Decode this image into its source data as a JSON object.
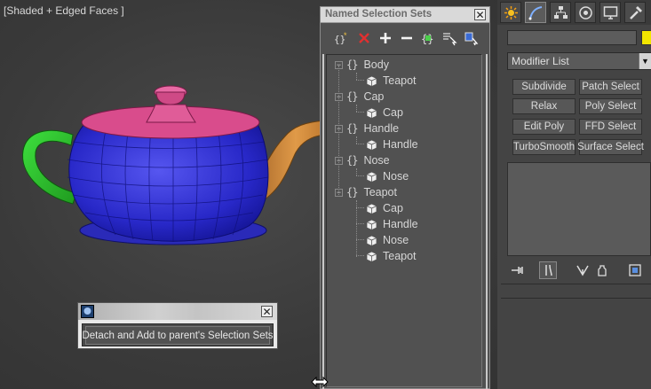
{
  "viewport": {
    "label": "[Shaded + Edged Faces ]",
    "teapot_parts": {
      "body": "#2e2ed4",
      "cap": "#d94c8c",
      "handle": "#2fc12f",
      "nose": "#d08a3a"
    }
  },
  "named_selection_sets": {
    "title": "Named Selection Sets",
    "toolbar": [
      {
        "name": "create-set-icon",
        "glyph": "{}*"
      },
      {
        "name": "delete-icon",
        "glyph": "✕"
      },
      {
        "name": "add-icon",
        "glyph": "+"
      },
      {
        "name": "subtract-icon",
        "glyph": "−"
      },
      {
        "name": "select-set-icon",
        "glyph": "{}"
      },
      {
        "name": "select-by-name-icon",
        "glyph": "▤"
      },
      {
        "name": "highlight-selected-icon",
        "glyph": "▦"
      }
    ],
    "tree": [
      {
        "type": "set",
        "label": "Body",
        "expander": "−"
      },
      {
        "type": "object",
        "label": "Teapot"
      },
      {
        "type": "set",
        "label": "Cap",
        "expander": "−"
      },
      {
        "type": "object",
        "label": "Cap"
      },
      {
        "type": "set",
        "label": "Handle",
        "expander": "−"
      },
      {
        "type": "object",
        "label": "Handle"
      },
      {
        "type": "set",
        "label": "Nose",
        "expander": "−"
      },
      {
        "type": "object",
        "label": "Nose"
      },
      {
        "type": "set",
        "label": "Teapot",
        "expander": "−"
      },
      {
        "type": "object",
        "label": "Cap"
      },
      {
        "type": "object",
        "label": "Handle"
      },
      {
        "type": "object",
        "label": "Nose"
      },
      {
        "type": "object",
        "label": "Teapot"
      }
    ]
  },
  "detach_dialog": {
    "button_label": "Detach and Add to parent's Selection Sets"
  },
  "command_panel": {
    "tabs": [
      "create-icon",
      "modify-icon",
      "hierarchy-icon",
      "motion-icon",
      "display-icon",
      "utilities-icon"
    ],
    "name_value": "",
    "color_swatch": "#f2e600",
    "modifier_list": "Modifier List",
    "modifier_buttons": [
      [
        "Subdivide",
        "Patch Select"
      ],
      [
        "Relax",
        "Poly Select"
      ],
      [
        "Edit Poly",
        "FFD Select"
      ],
      [
        "TurboSmooth",
        "Surface Select"
      ]
    ]
  }
}
